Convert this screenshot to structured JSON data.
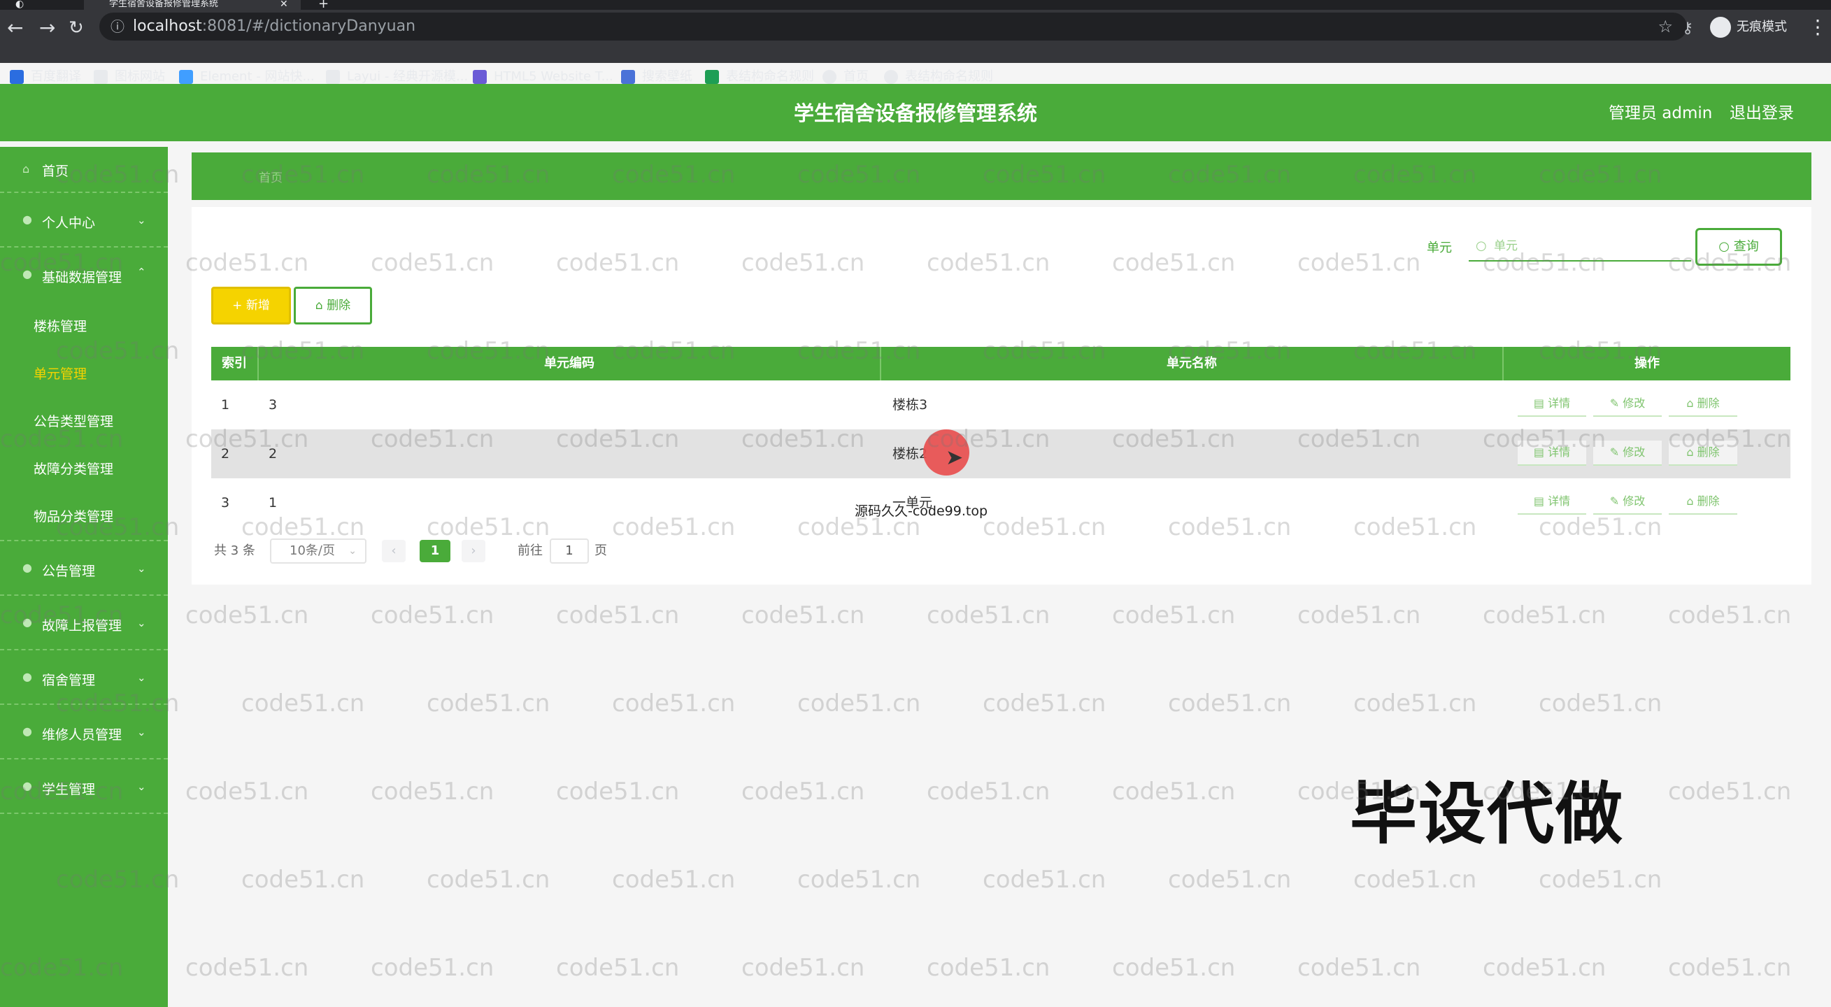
{
  "browser": {
    "tab_title": "学生宿舍设备报修管理系统",
    "url_host": "localhost",
    "url_path": ":8081/#/dictionaryDanyuan",
    "incognito_label": "无痕模式",
    "bookmarks": [
      {
        "label": "百度翻译",
        "color": "#2b6de0"
      },
      {
        "label": "图标网站",
        "color": "#e8eaed"
      },
      {
        "label": "Element - 网站快...",
        "color": "#409eff"
      },
      {
        "label": "Layui - 经典开源模...",
        "color": "#e8eaed"
      },
      {
        "label": "HTML5 Website T...",
        "color": "#6b5bd6"
      },
      {
        "label": "搜索壁纸",
        "color": "#4a72d8"
      },
      {
        "label": "表结构命名规则",
        "color": "#1e9e55"
      },
      {
        "label": "首页",
        "color": "#e8eaed"
      },
      {
        "label": "表结构命名规则",
        "color": "#e8eaed"
      }
    ]
  },
  "header": {
    "title": "学生宿舍设备报修管理系统",
    "admin_label": "管理员 admin",
    "logout_label": "退出登录"
  },
  "sidebar": {
    "items": [
      {
        "label": "首页"
      },
      {
        "label": "个人中心"
      },
      {
        "label": "基础数据管理"
      },
      {
        "label": "公告管理"
      },
      {
        "label": "故障上报管理"
      },
      {
        "label": "宿舍管理"
      },
      {
        "label": "维修人员管理"
      },
      {
        "label": "学生管理"
      }
    ],
    "subitems": [
      {
        "label": "楼栋管理"
      },
      {
        "label": "单元管理"
      },
      {
        "label": "公告类型管理"
      },
      {
        "label": "故障分类管理"
      },
      {
        "label": "物品分类管理"
      }
    ]
  },
  "banner": {
    "breadcrumb": "首页"
  },
  "search": {
    "label": "单元",
    "placeholder": "单元",
    "button_label": "查询"
  },
  "actions": {
    "add_label": "+ 新增",
    "delete_label": "删除"
  },
  "table": {
    "columns": [
      "索引",
      "单元编码",
      "单元名称",
      "操作"
    ],
    "rows": [
      {
        "index": "1",
        "code": "3",
        "name": "楼栋3"
      },
      {
        "index": "2",
        "code": "2",
        "name": "楼栋2"
      },
      {
        "index": "3",
        "code": "1",
        "name": "一单元"
      }
    ],
    "op_labels": {
      "detail": "详情",
      "edit": "修改",
      "delete": "删除"
    }
  },
  "pagination": {
    "total": "共 3 条",
    "page_size": "10条/页",
    "current": "1",
    "goto_label": "前往",
    "goto_value": "1",
    "page_suffix": "页"
  },
  "overlay": {
    "source_text": "源码久久-code99.top",
    "big_text": "毕设代做",
    "watermark": "code51.cn"
  },
  "colors": {
    "accent": "#4aab3a",
    "yellow": "#f5d300"
  }
}
